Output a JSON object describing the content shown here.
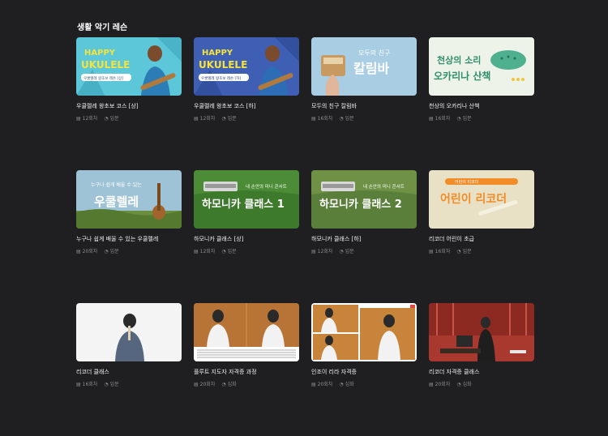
{
  "section": {
    "title": "생활 악기 레슨"
  },
  "cards": [
    {
      "title": "우쿨렐레 왕초보 코스 [상]",
      "lessons": "12회차",
      "level": "입문",
      "thumb": {
        "line1": "HAPPY",
        "line2": "UKULELE",
        "badge": "우쿨렐레 왕초보 레슨 [상]"
      }
    },
    {
      "title": "우쿨렐레 왕초보 코스 [하]",
      "lessons": "12회차",
      "level": "입문",
      "thumb": {
        "line1": "HAPPY",
        "line2": "UKULELE",
        "badge": "우쿨렐레 왕초보 레슨 [하]"
      }
    },
    {
      "title": "모두의 친구 칼림바",
      "lessons": "16회차",
      "level": "입문",
      "thumb": {
        "line1": "모두의 친구",
        "line2": "칼림바"
      }
    },
    {
      "title": "천상의 오카리나 산책",
      "lessons": "16회차",
      "level": "입문",
      "thumb": {
        "line1": "천상의 소리",
        "line2": "오카리나 산책"
      }
    },
    {
      "title": "누구나 쉽게 배울 수 있는 우쿨렐레",
      "lessons": "20회차",
      "level": "입문",
      "thumb": {
        "line1": "누구나 쉽게 배울 수 있는",
        "line2": "우쿨렐레"
      }
    },
    {
      "title": "하모니카 클래스 [상]",
      "lessons": "12회차",
      "level": "입문",
      "thumb": {
        "line1": "내 손안의 미니 콘서트",
        "line2": "하모니카 클래스 1"
      }
    },
    {
      "title": "하모니카 클래스 [하]",
      "lessons": "12회차",
      "level": "입문",
      "thumb": {
        "line1": "내 손안의 미니 콘서트",
        "line2": "하모니카 클래스 2"
      }
    },
    {
      "title": "리코더 어린이 초급",
      "lessons": "16회차",
      "level": "입문",
      "thumb": {
        "line1": "어린이 리코더",
        "line2": "어린이 리코더"
      }
    },
    {
      "title": "리코더 클래스",
      "lessons": "16회차",
      "level": "입문",
      "thumb": {}
    },
    {
      "title": "플루트 지도자 자격증 과정",
      "lessons": "20회차",
      "level": "심화",
      "thumb": {}
    },
    {
      "title": "인조이 리라 자격증",
      "lessons": "20회차",
      "level": "심화",
      "thumb": {}
    },
    {
      "title": "리코더 자격증 클래스",
      "lessons": "20회차",
      "level": "심화",
      "thumb": {}
    }
  ],
  "colors": {
    "background": "#1f1f21",
    "ukulele_bg": "#5cc7d8",
    "ukulele_bg2": "#3f5fb4",
    "grass": "#3e7a2c",
    "ocarina_bg": "#eef3ea"
  },
  "icons": {
    "lessons": "document-icon",
    "level": "gauge-icon"
  }
}
